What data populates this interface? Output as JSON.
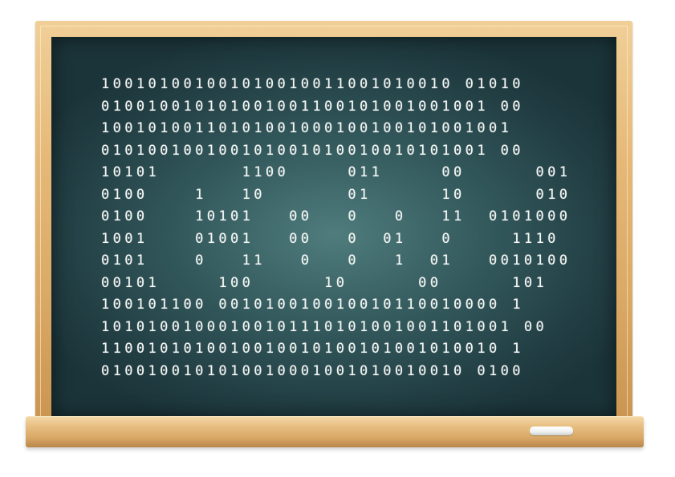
{
  "blackboard": {
    "binary_rows": [
      "100101001001010010011001010010 01010",
      "010010010101001001100101001001001 00",
      "10010100110101001000100100101001001",
      "010100100100101001010010010101001 00",
      "10101       1100     011     00      001",
      "0100    1   10       01      10      010",
      "0100    10101   00   0   0   11  0101000",
      "1001    01001   00   0  01   0     1110",
      "0101    0   11   0   0   1  01   0010100",
      "00101     100      10      00      101",
      "100101100 001010010010010110010000 1",
      "10101001000100101110101001001101001 00",
      "1100101010010010010100101001010010 1",
      "0100100101010010001001010010010 0100"
    ]
  }
}
